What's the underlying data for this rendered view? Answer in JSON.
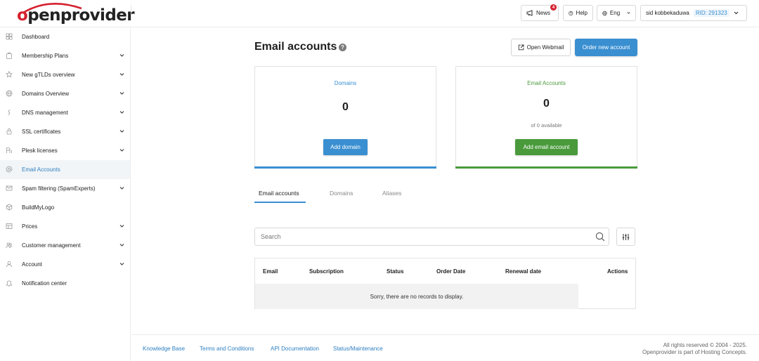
{
  "brand": {
    "name": "openprovider",
    "accent": "#d5212e"
  },
  "header": {
    "news_label": "News",
    "news_count": "4",
    "help_label": "Help",
    "language": "Eng",
    "user_name": "sid kobbekaduwa",
    "rid": "RID: 291323"
  },
  "sidebar": {
    "items": [
      {
        "label": "Dashboard",
        "icon": "dashboard-icon",
        "expandable": false,
        "active": false
      },
      {
        "label": "Membership Plans",
        "icon": "membership-icon",
        "expandable": true,
        "active": false
      },
      {
        "label": "New gTLDs overview",
        "icon": "star-icon",
        "expandable": true,
        "active": false
      },
      {
        "label": "Domains Overview",
        "icon": "globe-icon",
        "expandable": true,
        "active": false
      },
      {
        "label": "DNS management",
        "icon": "dns-icon",
        "expandable": true,
        "active": false
      },
      {
        "label": "SSL certificates",
        "icon": "lock-icon",
        "expandable": true,
        "active": false
      },
      {
        "label": "Plesk licenses",
        "icon": "plesk-icon",
        "expandable": true,
        "active": false
      },
      {
        "label": "Email Accounts",
        "icon": "at-icon",
        "expandable": false,
        "active": true
      },
      {
        "label": "Spam filtering (SpamExperts)",
        "icon": "mail-icon",
        "expandable": true,
        "active": false
      },
      {
        "label": "BuildMyLogo",
        "icon": "cube-icon",
        "expandable": false,
        "active": false
      },
      {
        "label": "Prices",
        "icon": "prices-icon",
        "expandable": true,
        "active": false
      },
      {
        "label": "Customer management",
        "icon": "customers-icon",
        "expandable": true,
        "active": false
      },
      {
        "label": "Account",
        "icon": "user-icon",
        "expandable": true,
        "active": false
      },
      {
        "label": "Notification center",
        "icon": "bell-icon",
        "expandable": false,
        "active": false
      }
    ]
  },
  "main": {
    "title": "Email accounts",
    "help_mark": "?",
    "open_webmail_label": "Open Webmail",
    "order_new_label": "Order new account",
    "cards": {
      "domains": {
        "label": "Domains",
        "value": "0",
        "button": "Add domain",
        "color": "#3a8fd1"
      },
      "email": {
        "label": "Email Accounts",
        "value": "0",
        "sub": "of 0 available",
        "button": "Add email account",
        "color": "#4a9a3c"
      }
    },
    "tabs": [
      "Email accounts",
      "Domains",
      "Aliases"
    ],
    "search_placeholder": "Search",
    "table": {
      "columns": [
        "Email",
        "Subscription",
        "Status",
        "Order Date",
        "Renewal date",
        "Actions"
      ],
      "empty_message": "Sorry, there are no records to display."
    }
  },
  "footer": {
    "links": [
      "Knowledge Base",
      "Terms and Conditions",
      "API Documentation",
      "Status/Maintenance"
    ],
    "copyright_line1": "All rights reserved © 2004 - 2025.",
    "copyright_line2": "Openprovider is part of Hosting Concepts."
  }
}
